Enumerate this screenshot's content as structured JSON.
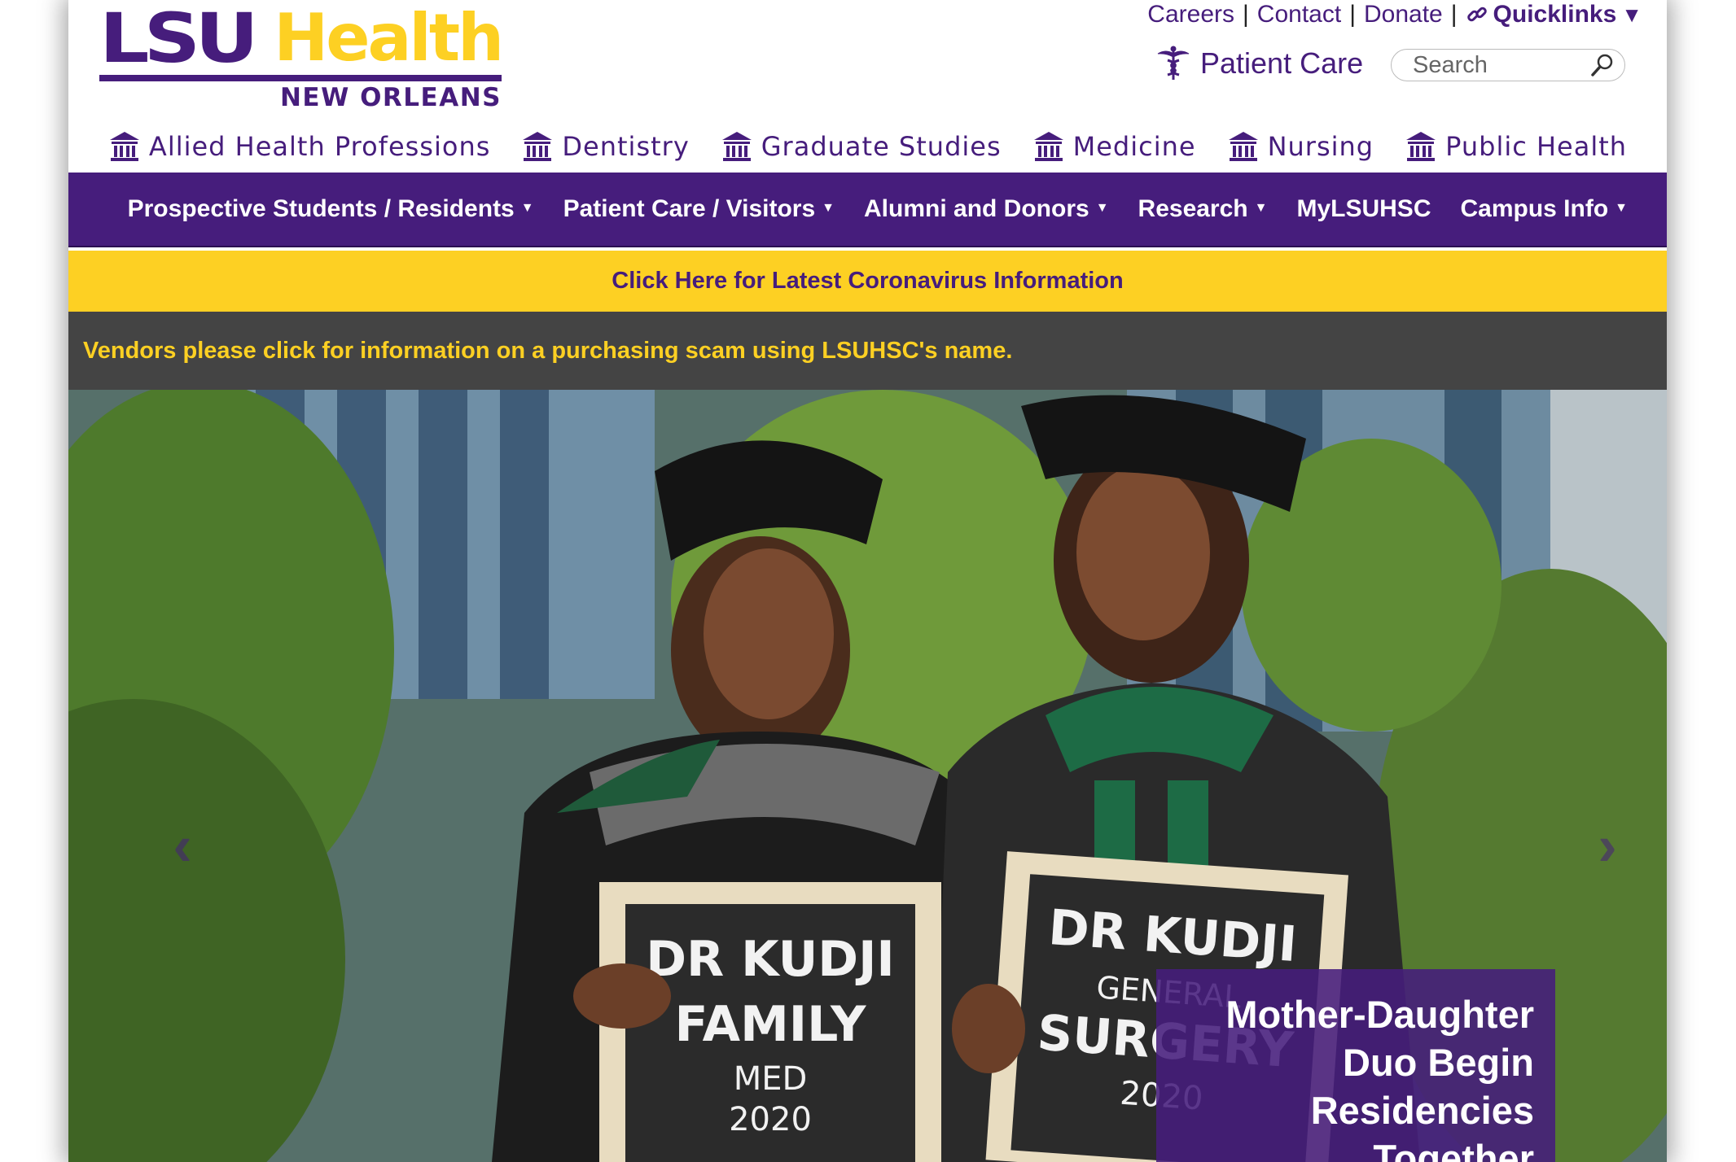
{
  "logo": {
    "wordmark": "LSU",
    "health": "Health",
    "city": "NEW ORLEANS"
  },
  "toplinks": {
    "careers": "Careers",
    "contact": "Contact",
    "donate": "Donate",
    "quicklinks": "Quicklinks",
    "separator": "|"
  },
  "patient_care": {
    "label": "Patient Care",
    "icon": "caduceus-icon"
  },
  "search": {
    "placeholder": "Search",
    "icon": "search-icon"
  },
  "schools": [
    {
      "label": "Allied Health Professions",
      "icon": "building-icon"
    },
    {
      "label": "Dentistry",
      "icon": "building-icon"
    },
    {
      "label": "Graduate Studies",
      "icon": "building-icon"
    },
    {
      "label": "Medicine",
      "icon": "building-icon"
    },
    {
      "label": "Nursing",
      "icon": "building-icon"
    },
    {
      "label": "Public Health",
      "icon": "building-icon"
    }
  ],
  "mainnav": [
    {
      "label": "Prospective Students / Residents",
      "dropdown": true
    },
    {
      "label": "Patient Care / Visitors",
      "dropdown": true
    },
    {
      "label": "Alumni and Donors",
      "dropdown": true
    },
    {
      "label": "Research",
      "dropdown": true
    },
    {
      "label": "MyLSUHSC",
      "dropdown": false
    },
    {
      "label": "Campus Info",
      "dropdown": true
    }
  ],
  "covid_banner": "Click Here for Latest Coronavirus Information",
  "vendor_banner": "Vendors please click for information on a purchasing scam using LSUHSC's name.",
  "hero": {
    "sign_left": {
      "line1": "DR KUDJI",
      "line2": "FAMILY",
      "line3": "MED",
      "line4": "2020"
    },
    "sign_right": {
      "line1": "DR KUDJI",
      "line2": "GENERAL",
      "line3": "SURGERY",
      "line4": "2020"
    },
    "caption": [
      "Mother-Daughter",
      "Duo Begin",
      "Residencies",
      "Together"
    ],
    "prev": "‹",
    "next": "›"
  },
  "colors": {
    "purple": "#461D7C",
    "gold": "#FDD023",
    "dark_banner": "#444444"
  }
}
